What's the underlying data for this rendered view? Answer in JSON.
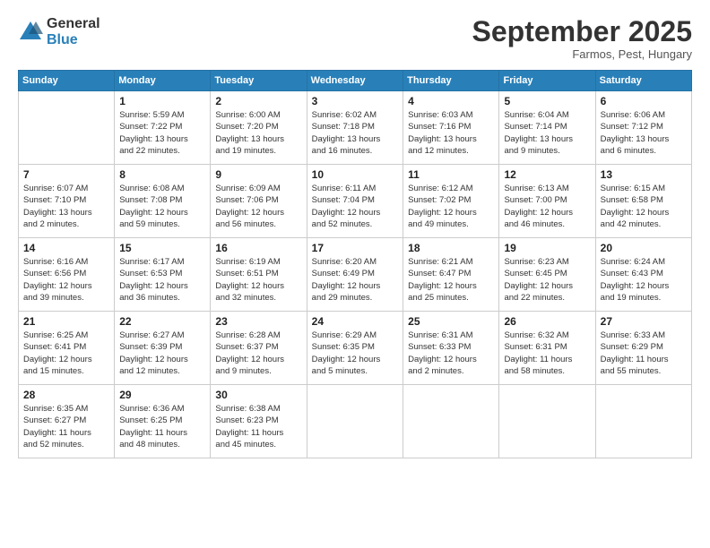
{
  "logo": {
    "general": "General",
    "blue": "Blue"
  },
  "title": "September 2025",
  "subtitle": "Farmos, Pest, Hungary",
  "header_days": [
    "Sunday",
    "Monday",
    "Tuesday",
    "Wednesday",
    "Thursday",
    "Friday",
    "Saturday"
  ],
  "weeks": [
    [
      {
        "day": "",
        "info": ""
      },
      {
        "day": "1",
        "info": "Sunrise: 5:59 AM\nSunset: 7:22 PM\nDaylight: 13 hours\nand 22 minutes."
      },
      {
        "day": "2",
        "info": "Sunrise: 6:00 AM\nSunset: 7:20 PM\nDaylight: 13 hours\nand 19 minutes."
      },
      {
        "day": "3",
        "info": "Sunrise: 6:02 AM\nSunset: 7:18 PM\nDaylight: 13 hours\nand 16 minutes."
      },
      {
        "day": "4",
        "info": "Sunrise: 6:03 AM\nSunset: 7:16 PM\nDaylight: 13 hours\nand 12 minutes."
      },
      {
        "day": "5",
        "info": "Sunrise: 6:04 AM\nSunset: 7:14 PM\nDaylight: 13 hours\nand 9 minutes."
      },
      {
        "day": "6",
        "info": "Sunrise: 6:06 AM\nSunset: 7:12 PM\nDaylight: 13 hours\nand 6 minutes."
      }
    ],
    [
      {
        "day": "7",
        "info": "Sunrise: 6:07 AM\nSunset: 7:10 PM\nDaylight: 13 hours\nand 2 minutes."
      },
      {
        "day": "8",
        "info": "Sunrise: 6:08 AM\nSunset: 7:08 PM\nDaylight: 12 hours\nand 59 minutes."
      },
      {
        "day": "9",
        "info": "Sunrise: 6:09 AM\nSunset: 7:06 PM\nDaylight: 12 hours\nand 56 minutes."
      },
      {
        "day": "10",
        "info": "Sunrise: 6:11 AM\nSunset: 7:04 PM\nDaylight: 12 hours\nand 52 minutes."
      },
      {
        "day": "11",
        "info": "Sunrise: 6:12 AM\nSunset: 7:02 PM\nDaylight: 12 hours\nand 49 minutes."
      },
      {
        "day": "12",
        "info": "Sunrise: 6:13 AM\nSunset: 7:00 PM\nDaylight: 12 hours\nand 46 minutes."
      },
      {
        "day": "13",
        "info": "Sunrise: 6:15 AM\nSunset: 6:58 PM\nDaylight: 12 hours\nand 42 minutes."
      }
    ],
    [
      {
        "day": "14",
        "info": "Sunrise: 6:16 AM\nSunset: 6:56 PM\nDaylight: 12 hours\nand 39 minutes."
      },
      {
        "day": "15",
        "info": "Sunrise: 6:17 AM\nSunset: 6:53 PM\nDaylight: 12 hours\nand 36 minutes."
      },
      {
        "day": "16",
        "info": "Sunrise: 6:19 AM\nSunset: 6:51 PM\nDaylight: 12 hours\nand 32 minutes."
      },
      {
        "day": "17",
        "info": "Sunrise: 6:20 AM\nSunset: 6:49 PM\nDaylight: 12 hours\nand 29 minutes."
      },
      {
        "day": "18",
        "info": "Sunrise: 6:21 AM\nSunset: 6:47 PM\nDaylight: 12 hours\nand 25 minutes."
      },
      {
        "day": "19",
        "info": "Sunrise: 6:23 AM\nSunset: 6:45 PM\nDaylight: 12 hours\nand 22 minutes."
      },
      {
        "day": "20",
        "info": "Sunrise: 6:24 AM\nSunset: 6:43 PM\nDaylight: 12 hours\nand 19 minutes."
      }
    ],
    [
      {
        "day": "21",
        "info": "Sunrise: 6:25 AM\nSunset: 6:41 PM\nDaylight: 12 hours\nand 15 minutes."
      },
      {
        "day": "22",
        "info": "Sunrise: 6:27 AM\nSunset: 6:39 PM\nDaylight: 12 hours\nand 12 minutes."
      },
      {
        "day": "23",
        "info": "Sunrise: 6:28 AM\nSunset: 6:37 PM\nDaylight: 12 hours\nand 9 minutes."
      },
      {
        "day": "24",
        "info": "Sunrise: 6:29 AM\nSunset: 6:35 PM\nDaylight: 12 hours\nand 5 minutes."
      },
      {
        "day": "25",
        "info": "Sunrise: 6:31 AM\nSunset: 6:33 PM\nDaylight: 12 hours\nand 2 minutes."
      },
      {
        "day": "26",
        "info": "Sunrise: 6:32 AM\nSunset: 6:31 PM\nDaylight: 11 hours\nand 58 minutes."
      },
      {
        "day": "27",
        "info": "Sunrise: 6:33 AM\nSunset: 6:29 PM\nDaylight: 11 hours\nand 55 minutes."
      }
    ],
    [
      {
        "day": "28",
        "info": "Sunrise: 6:35 AM\nSunset: 6:27 PM\nDaylight: 11 hours\nand 52 minutes."
      },
      {
        "day": "29",
        "info": "Sunrise: 6:36 AM\nSunset: 6:25 PM\nDaylight: 11 hours\nand 48 minutes."
      },
      {
        "day": "30",
        "info": "Sunrise: 6:38 AM\nSunset: 6:23 PM\nDaylight: 11 hours\nand 45 minutes."
      },
      {
        "day": "",
        "info": ""
      },
      {
        "day": "",
        "info": ""
      },
      {
        "day": "",
        "info": ""
      },
      {
        "day": "",
        "info": ""
      }
    ]
  ]
}
